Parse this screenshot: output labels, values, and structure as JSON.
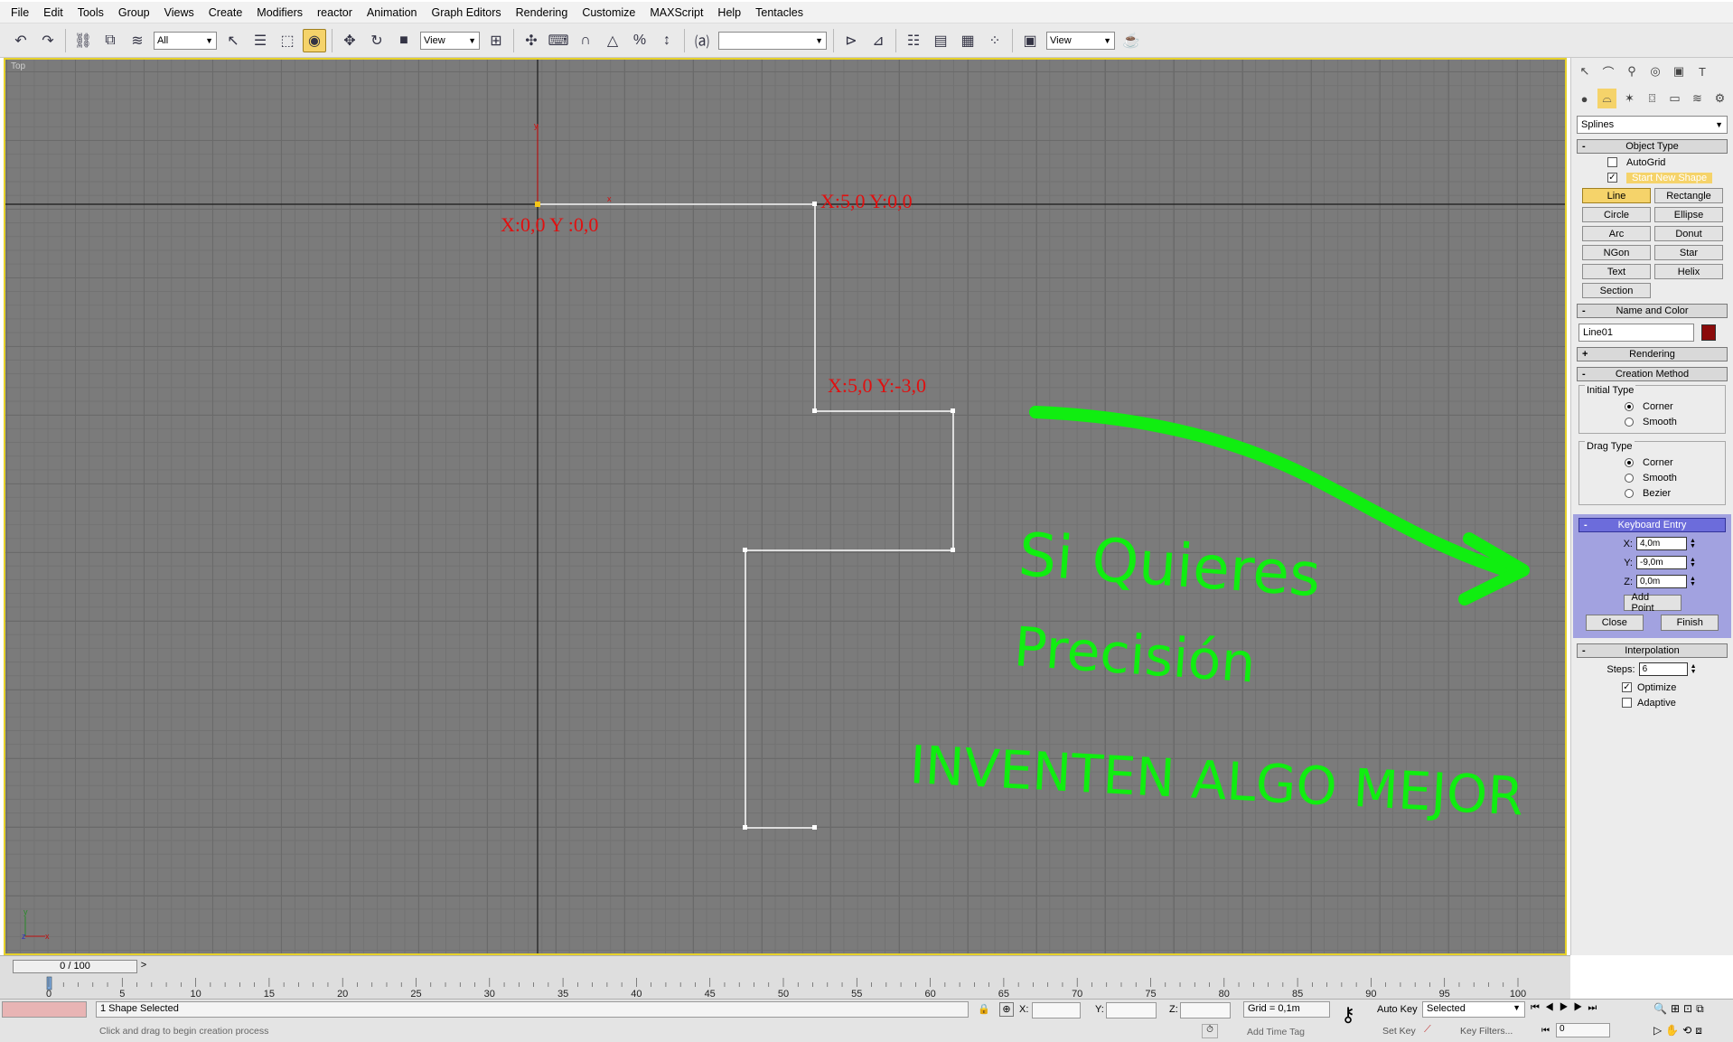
{
  "menu": [
    "File",
    "Edit",
    "Tools",
    "Group",
    "Views",
    "Create",
    "Modifiers",
    "reactor",
    "Animation",
    "Graph Editors",
    "Rendering",
    "Customize",
    "MAXScript",
    "Help",
    "Tentacles"
  ],
  "toolbar": {
    "selection_filter": "All",
    "ref_coord": "View",
    "named_selection": "",
    "render_view": "View"
  },
  "viewport": {
    "label": "Top",
    "annotations": {
      "origin": "X:0,0  Y :0,0",
      "pt2": "X:5,0 Y:0,0",
      "pt3": "X:5,0 Y:-3,0"
    },
    "handwriting": {
      "line1": "Si Quieres",
      "line2": "Precisión",
      "line3": "INVENTEN ALGO MEJOR"
    },
    "colors": {
      "grid_bg": "#7b7b7b",
      "spline": "#ffffff",
      "annotation_red": "#e01010",
      "handwriting_green": "#10ee10",
      "viewport_border": "#e6d12a"
    }
  },
  "command_panel": {
    "category": "Splines",
    "object_type": {
      "title": "Object Type",
      "autogrid": "AutoGrid",
      "start_new_shape": "Start New Shape",
      "buttons": [
        "Line",
        "Rectangle",
        "Circle",
        "Ellipse",
        "Arc",
        "Donut",
        "NGon",
        "Star",
        "Text",
        "Helix",
        "Section"
      ]
    },
    "name_color": {
      "title": "Name and Color",
      "name": "Line01",
      "swatch": "#8b0b0b"
    },
    "rendering": {
      "title": "Rendering"
    },
    "creation_method": {
      "title": "Creation Method",
      "initial_type": {
        "title": "Initial Type",
        "options": [
          "Corner",
          "Smooth"
        ],
        "selected": "Corner"
      },
      "drag_type": {
        "title": "Drag Type",
        "options": [
          "Corner",
          "Smooth",
          "Bezier"
        ],
        "selected": "Corner"
      }
    },
    "keyboard_entry": {
      "title": "Keyboard Entry",
      "x_label": "X:",
      "x": "4,0m",
      "y_label": "Y:",
      "y": "-9,0m",
      "z_label": "Z:",
      "z": "0,0m",
      "add_point": "Add Point",
      "close": "Close",
      "finish": "Finish"
    },
    "interpolation": {
      "title": "Interpolation",
      "steps_label": "Steps:",
      "steps": "6",
      "optimize": "Optimize",
      "adaptive": "Adaptive"
    }
  },
  "timeline": {
    "slider": "0 / 100",
    "ticks": [
      "0",
      "5",
      "10",
      "15",
      "20",
      "25",
      "30",
      "35",
      "40",
      "45",
      "50",
      "55",
      "60",
      "65",
      "70",
      "75",
      "80",
      "85",
      "90",
      "95",
      "100"
    ]
  },
  "status": {
    "selection": "1 Shape Selected",
    "prompt": "Click and drag to begin creation process",
    "x_label": "X:",
    "y_label": "Y:",
    "z_label": "Z:",
    "grid": "Grid = 0,1m",
    "add_time_tag": "Add Time Tag",
    "auto_key": "Auto Key",
    "key_mode": "Selected",
    "set_key": "Set Key",
    "key_filters": "Key Filters...",
    "frame": "0"
  }
}
